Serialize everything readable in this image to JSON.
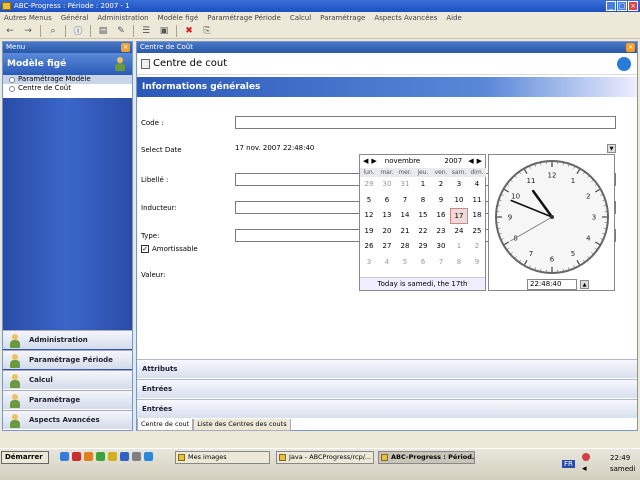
{
  "window": {
    "title": "ABC-Progress : Période : 2007 - 1"
  },
  "menubar": [
    "Autres Menus",
    "Général",
    "Administration",
    "Modèle figé",
    "Paramétrage Période",
    "Calcul",
    "Paramétrage",
    "Aspects Avancées",
    "Aide"
  ],
  "left_panel": {
    "header": "Menu",
    "model_title": "Modèle figé",
    "tree": [
      {
        "label": "Paramétrage Modèle",
        "selected": true
      },
      {
        "label": "Centre de Coût",
        "selected": false
      }
    ],
    "nav": [
      "Administration",
      "Paramétrage Période",
      "Calcul",
      "Paramétrage",
      "Aspects Avancées"
    ]
  },
  "right_panel": {
    "header": "Centre de Coût",
    "title": "Centre de cout",
    "section": "Informations générales",
    "fields": {
      "code_label": "Code :",
      "date_label": "Select Date",
      "date_value": "17 nov. 2007 22:48:40",
      "libelle_label": "Libellé :",
      "inducteur_label": "Inducteur:",
      "type_label": "Type:",
      "amortissable_label": "Amortissable",
      "amortissable_checked": true,
      "valeur_label": "Valeur:"
    },
    "accordions": [
      "Attributs",
      "Entrées",
      "Entrées"
    ],
    "tabs": [
      "Centre de cout",
      "Liste des Centres des couts"
    ]
  },
  "calendar": {
    "month": "novembre",
    "year": "2007",
    "day_names": [
      "lun.",
      "mar.",
      "mer.",
      "jeu.",
      "ven.",
      "sam.",
      "dim."
    ],
    "days": [
      [
        "29",
        "30",
        "31",
        "1",
        "2",
        "3",
        "4"
      ],
      [
        "5",
        "6",
        "7",
        "8",
        "9",
        "10",
        "11"
      ],
      [
        "12",
        "13",
        "14",
        "15",
        "16",
        "17",
        "18"
      ],
      [
        "19",
        "20",
        "21",
        "22",
        "23",
        "24",
        "25"
      ],
      [
        "26",
        "27",
        "28",
        "29",
        "30",
        "1",
        "2"
      ],
      [
        "3",
        "4",
        "5",
        "6",
        "7",
        "8",
        "9"
      ]
    ],
    "today": "17",
    "footer": "Today is samedi, the 17th"
  },
  "clock": {
    "numbers": [
      "12",
      "1",
      "2",
      "3",
      "4",
      "5",
      "6",
      "7",
      "8",
      "9",
      "10",
      "11"
    ],
    "hours": 22,
    "minutes": 48,
    "seconds": 40,
    "time_text": "22:48:40"
  },
  "taskbar": {
    "start": "Démarrer",
    "tasks": [
      {
        "label": "Mes images",
        "active": false
      },
      {
        "label": "Java - ABCProgress/rcp/...",
        "active": false
      },
      {
        "label": "ABC-Progress : Périod...",
        "active": true
      }
    ],
    "lang": "FR",
    "time": "22:49",
    "day": "samedi"
  },
  "colors": {
    "accent": "#2a58b8",
    "title_bar": "#1c4fc0",
    "nav_blue": "#2a4ca8"
  }
}
